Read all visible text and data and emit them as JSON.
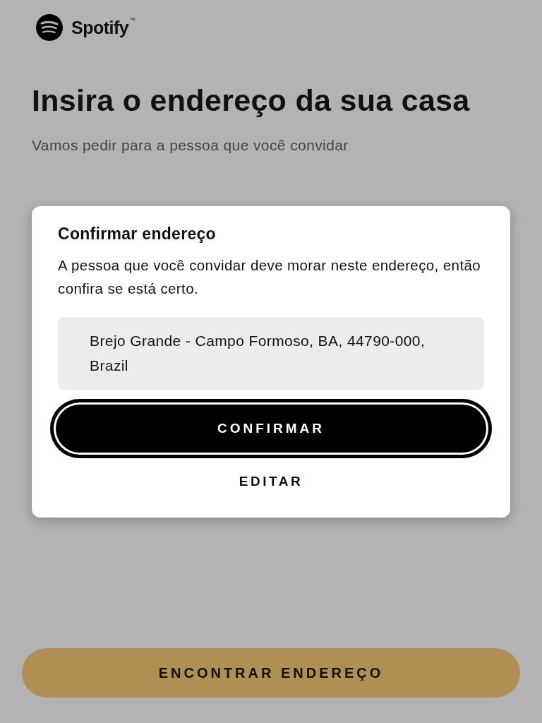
{
  "logo": {
    "text": "Spotify",
    "mark": "™"
  },
  "heading": "Insira o endereço da sua casa",
  "subtitle": "Vamos pedir para a pessoa que você convidar",
  "dialog": {
    "title": "Confirmar endereço",
    "message": "A pessoa que você convidar deve morar neste endereço, então confira se está certo.",
    "address": "Brejo Grande - Campo Formoso, BA, 44790-000, Brazil",
    "buttons": [
      {
        "kind": "primary",
        "label": "CONFIRMAR"
      },
      {
        "kind": "text",
        "label": "EDITAR"
      }
    ]
  },
  "footer_button": "ENCONTRAR ENDEREÇO"
}
